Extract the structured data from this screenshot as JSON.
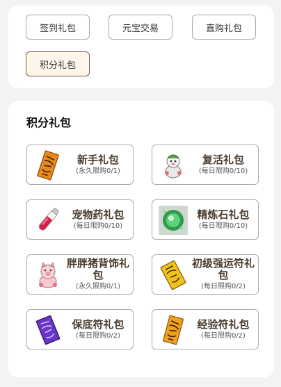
{
  "tabs": [
    {
      "label": "签到礼包"
    },
    {
      "label": "元宝交易"
    },
    {
      "label": "直购礼包"
    },
    {
      "label": "积分礼包"
    }
  ],
  "active_tab": "积分礼包",
  "section": {
    "title": "积分礼包"
  },
  "gifts": [
    {
      "name": "新手礼包",
      "limit": "(永久限购0/1)",
      "icon": "orange-talisman-icon"
    },
    {
      "name": "复活礼包",
      "limit": "(每日限购0/10)",
      "icon": "white-doll-icon"
    },
    {
      "name": "宠物药礼包",
      "limit": "(每日限购0/10)",
      "icon": "red-potion-icon"
    },
    {
      "name": "精炼石礼包",
      "limit": "(每日限购0/10)",
      "icon": "green-stone-icon"
    },
    {
      "name": "胖胖猪背饰礼包",
      "limit": "(永久限购0/1)",
      "icon": "pink-pig-icon"
    },
    {
      "name": "初级强运符礼包",
      "limit": "(每日限购0/2)",
      "icon": "yellow-talisman-icon"
    },
    {
      "name": "保底符礼包",
      "limit": "(每日限购0/2)",
      "icon": "purple-talisman-icon"
    },
    {
      "name": "经验符礼包",
      "limit": "(每日限购0/2)",
      "icon": "orange-talisman-icon"
    }
  ],
  "colors": {
    "background": "#f3f3f3",
    "active_tab_bg": "#fff6ea",
    "gift_name": "#4a3b2c"
  }
}
